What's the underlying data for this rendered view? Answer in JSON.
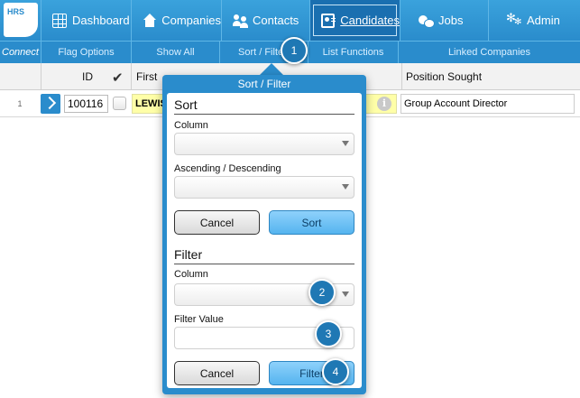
{
  "app": {
    "logo_text": "HRS"
  },
  "nav": {
    "items": [
      {
        "label": "Dashboard",
        "icon": "grid-icon"
      },
      {
        "label": "Companies",
        "icon": "house-icon"
      },
      {
        "label": "Contacts",
        "icon": "people-icon"
      },
      {
        "label": "Candidates",
        "icon": "id-card-icon",
        "active": true
      },
      {
        "label": "Jobs",
        "icon": "jobs-icon"
      },
      {
        "label": "Admin",
        "icon": "gear-icon"
      }
    ]
  },
  "toolbar": {
    "items": [
      {
        "label": "Connect"
      },
      {
        "label": "Flag Options"
      },
      {
        "label": "Show All"
      },
      {
        "label": "Sort / Filter"
      },
      {
        "label": "List Functions"
      },
      {
        "label": "Linked Companies"
      }
    ]
  },
  "table": {
    "columns": [
      {
        "label": "ID"
      },
      {
        "label": "First"
      },
      {
        "label": "Position Sought"
      }
    ],
    "rows": [
      {
        "row_number": "1",
        "id": "100116",
        "first": "LEWIS",
        "position_sought": "Group Account Director"
      }
    ]
  },
  "popover": {
    "title": "Sort / Filter",
    "sort": {
      "heading": "Sort",
      "column_label": "Column",
      "column_value": "",
      "order_label": "Ascending / Descending",
      "order_value": "",
      "cancel_label": "Cancel",
      "submit_label": "Sort"
    },
    "filter": {
      "heading": "Filter",
      "column_label": "Column",
      "column_value": "",
      "value_label": "Filter Value",
      "value_text": "",
      "cancel_label": "Cancel",
      "submit_label": "Filter"
    }
  },
  "steps": [
    "1",
    "2",
    "3",
    "4"
  ],
  "colors": {
    "nav_bg": "#2a8ccc",
    "nav_active": "#1a6fb0",
    "step_badge": "#1f78b4",
    "highlight": "#ffffa8"
  }
}
